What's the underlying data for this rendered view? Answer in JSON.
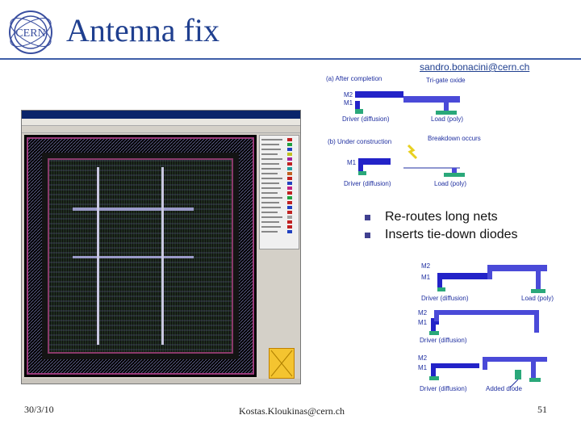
{
  "slide": {
    "title": "Antenna fix",
    "email_top": "sandro.bonacini@cern.ch",
    "bullets": [
      "Re-routes long nets",
      "Inserts tie-down diodes"
    ],
    "footer_date": "30/3/10",
    "footer_author": "Kostas.Kloukinas@cern.ch",
    "page_number": "51"
  },
  "diagram_top": {
    "a_label": "(a) After completion",
    "trig_label": "Tri-gate oxide",
    "m2": "M2",
    "m1": "M1",
    "driver": "Driver (diffusion)",
    "load": "Load (poly)",
    "b_label": "(b) Under construction",
    "breakdown": "Breakdown occurs",
    "m1b": "M1",
    "driver_b": "Driver (diffusion)",
    "load_b": "Load (poly)"
  },
  "diagram_bottom": {
    "p1": {
      "m2": "M2",
      "m1": "M1",
      "driver": "Driver (diffusion)",
      "load": "Load (poly)"
    },
    "p2": {
      "m2": "M2",
      "m1": "M1",
      "driver": "Driver (diffusion)"
    },
    "p3": {
      "m2": "M2",
      "m1": "M1",
      "driver": "Driver (diffusion)",
      "diode": "Added diode"
    }
  },
  "colors": {
    "accent": "#1f3f8f",
    "metal1": "#2323c8",
    "metal2": "#4a4ad8",
    "diffusion": "#2aa87a",
    "window_bg": "#d4d0c8"
  }
}
